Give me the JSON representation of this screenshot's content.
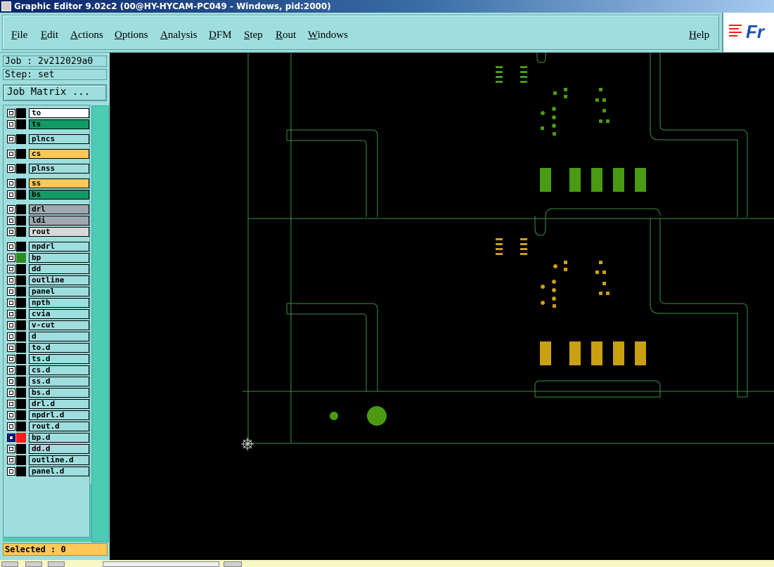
{
  "window": {
    "title": "Graphic Editor 9.02c2 (00@HY-HYCAM-PC049 - Windows, pid:2000)"
  },
  "menubar": {
    "items": [
      "File",
      "Edit",
      "Actions",
      "Options",
      "Analysis",
      "DFM",
      "Step",
      "Rout",
      "Windows"
    ],
    "help": "Help",
    "logo_text": "Fr"
  },
  "job": {
    "job_label": "Job : 2v212029a0",
    "step_label": "Step: set",
    "matrix_button": "Job Matrix ..."
  },
  "layers": [
    {
      "name": "to",
      "bg": "#ffffff",
      "swatch": "#000000"
    },
    {
      "name": "ts",
      "bg": "#119966",
      "swatch": "#000000"
    },
    {
      "name": "plncs",
      "bg": "#9fdede",
      "swatch": "#000000"
    },
    {
      "name": "cs",
      "bg": "#ffc857",
      "swatch": "#000000"
    },
    {
      "name": "plnss",
      "bg": "#9fdede",
      "swatch": "#000000"
    },
    {
      "name": "ss",
      "bg": "#ffc857",
      "swatch": "#000000"
    },
    {
      "name": "bs",
      "bg": "#119966",
      "swatch": "#000000"
    },
    {
      "name": "drl",
      "bg": "#a0a8b0",
      "swatch": "#000000"
    },
    {
      "name": "ldi",
      "bg": "#a0a8b0",
      "swatch": "#000000"
    },
    {
      "name": "rout",
      "bg": "#d8d8d8",
      "swatch": "#000000"
    },
    {
      "name": "npdrl",
      "bg": "#9fdede",
      "swatch": "#000000"
    },
    {
      "name": "bp",
      "bg": "#9fdede",
      "swatch": "#2e8b1e"
    },
    {
      "name": "dd",
      "bg": "#9fdede",
      "swatch": "#000000"
    },
    {
      "name": "outline",
      "bg": "#9fdede",
      "swatch": "#000000"
    },
    {
      "name": "panel",
      "bg": "#9fdede",
      "swatch": "#000000"
    },
    {
      "name": "npth",
      "bg": "#9fdede",
      "swatch": "#000000"
    },
    {
      "name": "cvia",
      "bg": "#9fdede",
      "swatch": "#000000"
    },
    {
      "name": "v-cut",
      "bg": "#9fdede",
      "swatch": "#000000"
    },
    {
      "name": "d",
      "bg": "#9fdede",
      "swatch": "#000000"
    },
    {
      "name": "to.d",
      "bg": "#9fdede",
      "swatch": "#000000"
    },
    {
      "name": "ts.d",
      "bg": "#9fdede",
      "swatch": "#000000"
    },
    {
      "name": "cs.d",
      "bg": "#9fdede",
      "swatch": "#000000"
    },
    {
      "name": "ss.d",
      "bg": "#9fdede",
      "swatch": "#000000"
    },
    {
      "name": "bs.d",
      "bg": "#9fdede",
      "swatch": "#000000"
    },
    {
      "name": "drl.d",
      "bg": "#9fdede",
      "swatch": "#000000"
    },
    {
      "name": "npdrl.d",
      "bg": "#9fdede",
      "swatch": "#000000"
    },
    {
      "name": "rout.d",
      "bg": "#9fdede",
      "swatch": "#000000"
    },
    {
      "name": "bp.d",
      "bg": "#9fdede",
      "swatch": "#ff1a1a",
      "active": true
    },
    {
      "name": "dd.d",
      "bg": "#9fdede",
      "swatch": "#000000"
    },
    {
      "name": "outline.d",
      "bg": "#9fdede",
      "swatch": "#000000"
    },
    {
      "name": "panel.d",
      "bg": "#9fdede",
      "swatch": "#000000"
    }
  ],
  "status": {
    "selected": "Selected : 0"
  },
  "colors": {
    "pad_green": "#4a9a12",
    "pad_gold": "#c9a012",
    "outline_green": "#3f8f3f"
  }
}
